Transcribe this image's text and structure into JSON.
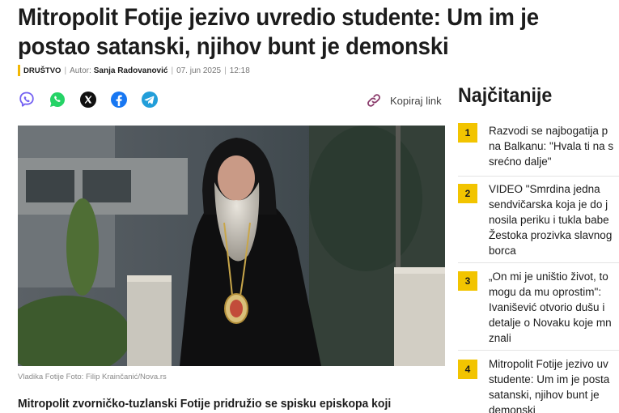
{
  "article": {
    "headline_line1": "Mitropolit Fotije jezivo uvredio studente: Um im je",
    "headline_line2": "postao satanski, njihov bunt je demonski",
    "category": "DRUŠTVO",
    "author_label": "Autor:",
    "author": "Sanja Radovanović",
    "date": "07. jun 2025",
    "time": "12:18",
    "caption": "Vladika Fotije Foto: Filip Krainčanić/Nova.rs",
    "lead": "Mitropolit zvorničko-tuzlanski Fotije pridružio se spisku episkopa koji"
  },
  "share": {
    "icons": [
      "viber-icon",
      "whatsapp-icon",
      "x-icon",
      "facebook-icon",
      "telegram-icon"
    ],
    "copy_link_label": "Kopiraj link"
  },
  "sidebar": {
    "title": "Najčitanije",
    "items": [
      {
        "num": "1",
        "lines": [
          "Razvodi se najbogatija p",
          "na Balkanu: \"Hvala ti na s",
          "srećno dalje\""
        ]
      },
      {
        "num": "2",
        "lines": [
          "VIDEO \"Smrdina jedna",
          "sendvičarska koja je do j",
          "nosila periku i tukla babe",
          "Žestoka prozivka slavnog",
          "borca"
        ]
      },
      {
        "num": "3",
        "lines": [
          "„On mi je uništio život, to",
          "mogu da mu oprostim\":",
          "Ivanišević otvorio dušu i",
          "detalje o Novaku koje mn",
          "znali"
        ]
      },
      {
        "num": "4",
        "lines": [
          "Mitropolit Fotije jezivo uv",
          "studente: Um im je posta",
          "satanski, njihov bunt je",
          "demonski"
        ]
      }
    ]
  },
  "colors": {
    "accent": "#f2c400",
    "viber": "#7360f2",
    "whatsapp": "#25d366",
    "facebook": "#1877f2",
    "telegram": "#229ed9"
  }
}
